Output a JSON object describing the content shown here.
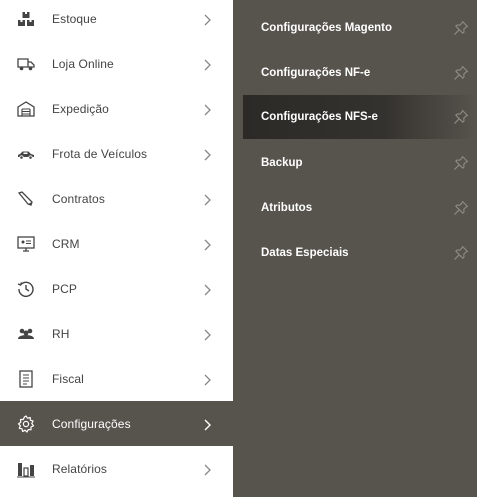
{
  "menu": {
    "items": [
      {
        "label": "Estoque",
        "icon": "boxes-icon"
      },
      {
        "label": "Loja Online",
        "icon": "truck-icon"
      },
      {
        "label": "Expedição",
        "icon": "warehouse-icon"
      },
      {
        "label": "Frota de Veículos",
        "icon": "car-icon"
      },
      {
        "label": "Contratos",
        "icon": "pen-icon"
      },
      {
        "label": "CRM",
        "icon": "monitor-icon"
      },
      {
        "label": "PCP",
        "icon": "clock-icon"
      },
      {
        "label": "RH",
        "icon": "users-icon"
      },
      {
        "label": "Fiscal",
        "icon": "document-icon"
      },
      {
        "label": "Configurações",
        "icon": "gear-icon",
        "active": true
      },
      {
        "label": "Relatórios",
        "icon": "bar-chart-icon"
      }
    ]
  },
  "submenu": {
    "items": [
      {
        "label": "Configurações Magento"
      },
      {
        "label": "Configurações NF-e"
      },
      {
        "label": "Configurações NFS-e",
        "active": true
      },
      {
        "label": "Backup"
      },
      {
        "label": "Atributos"
      },
      {
        "label": "Datas Especiais"
      }
    ]
  },
  "colors": {
    "sidebar_bg": "#ffffff",
    "active_bg": "#57544e",
    "submenu_bg": "#57544e",
    "submenu_active_bg": "#2b2a27",
    "text": "#444444",
    "pin": "#8e8b84"
  }
}
